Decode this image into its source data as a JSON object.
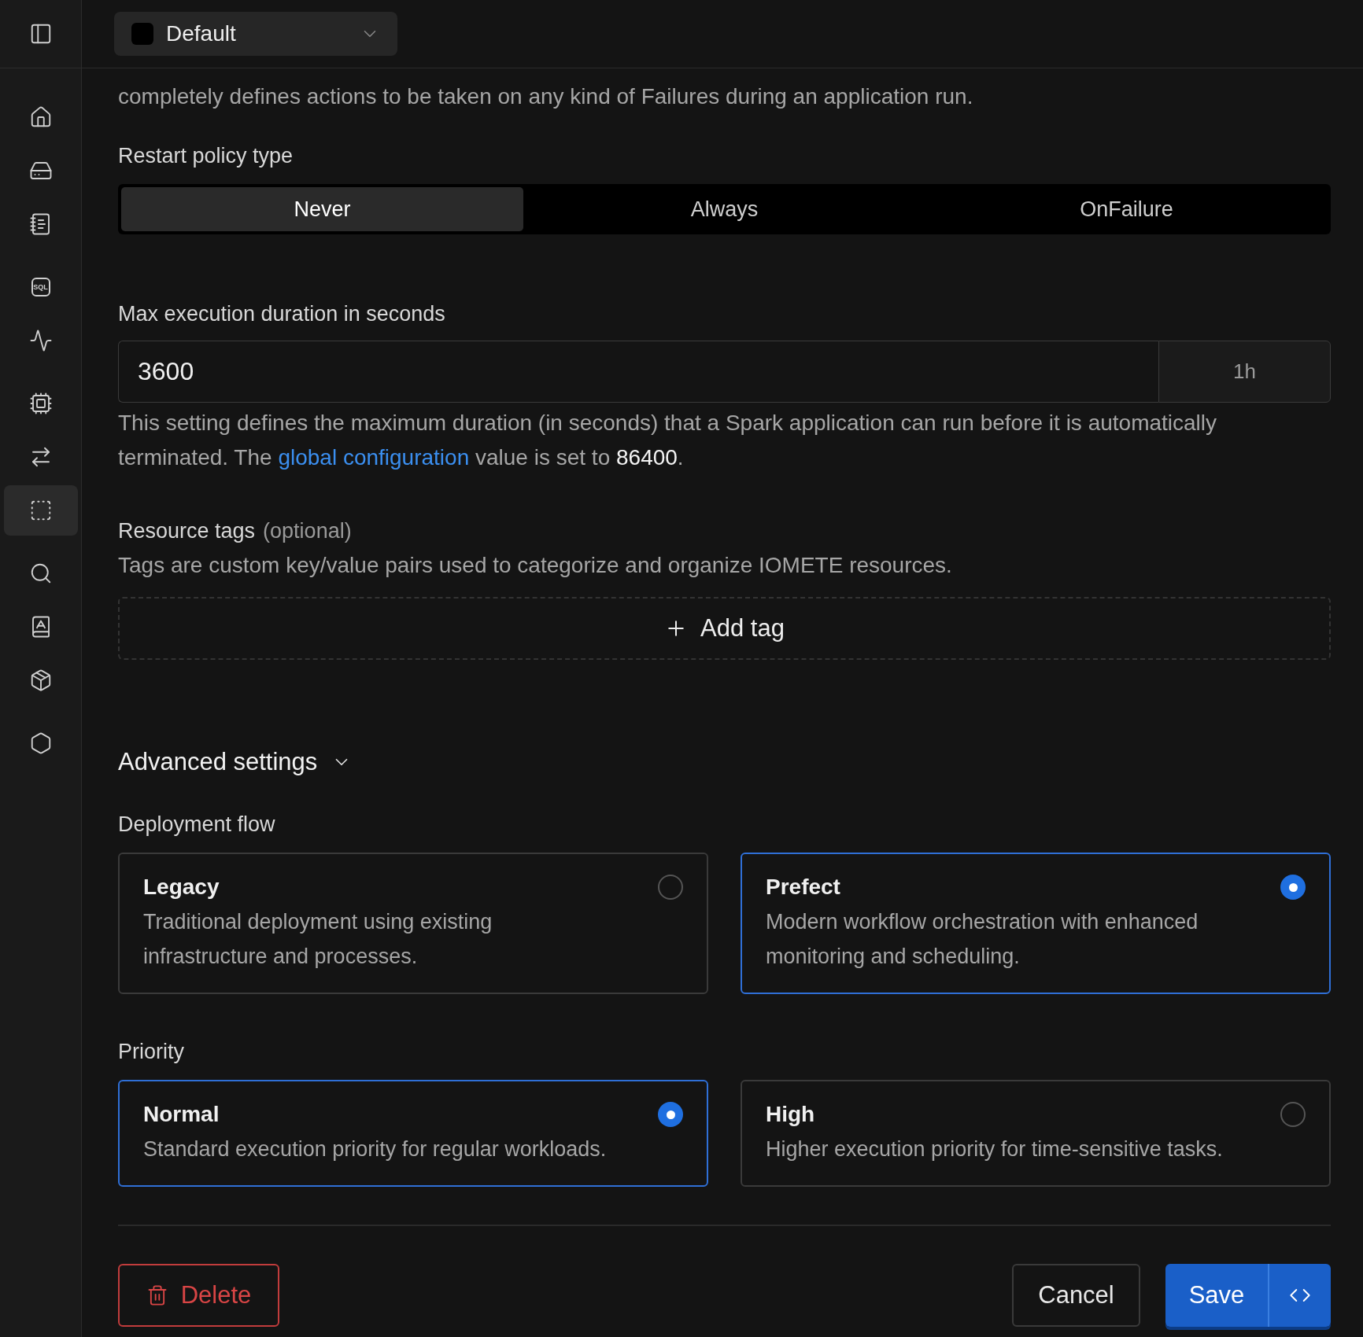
{
  "sidebar": {
    "toggle": {
      "kind": "panel"
    },
    "items": [
      {
        "kind": "home",
        "selected": false
      },
      {
        "kind": "drive",
        "selected": false
      },
      {
        "kind": "notebook",
        "selected": false
      },
      {
        "kind": "sql",
        "label": "SQL",
        "selected": false
      },
      {
        "kind": "activity",
        "selected": false
      },
      {
        "kind": "chip",
        "selected": false
      },
      {
        "kind": "transfer",
        "selected": false
      },
      {
        "kind": "dashed",
        "selected": true
      },
      {
        "kind": "search",
        "selected": false
      },
      {
        "kind": "book",
        "selected": false
      },
      {
        "kind": "package",
        "selected": false
      },
      {
        "kind": "hexagon",
        "selected": false
      }
    ]
  },
  "header": {
    "selector": {
      "label": "Default",
      "color": "#000000"
    }
  },
  "restart_policy": {
    "description": "completely defines actions to be taken on any kind of Failures during an application run.",
    "label": "Restart policy type",
    "options": [
      {
        "label": "Never",
        "selected": true
      },
      {
        "label": "Always",
        "selected": false
      },
      {
        "label": "OnFailure",
        "selected": false
      }
    ]
  },
  "max_duration": {
    "label": "Max execution duration in seconds",
    "value": "3600",
    "suffix": "1h",
    "help": "This setting defines the maximum duration (in seconds) that a Spark application can run before it is automatically terminated. The ",
    "link": "global configuration",
    "help_end": " value is set to ",
    "global_value": "86400",
    "period": "."
  },
  "resource_tags": {
    "label": "Resource tags",
    "optional": "(optional)",
    "description": "Tags are custom key/value pairs used to categorize and organize IOMETE resources.",
    "add_button": "Add tag"
  },
  "advanced": {
    "title": "Advanced settings",
    "expanded": true
  },
  "deployment_flow": {
    "label": "Deployment flow",
    "options": [
      {
        "title": "Legacy",
        "description": "Traditional deployment using existing infrastructure and processes.",
        "selected": false
      },
      {
        "title": "Prefect",
        "description": "Modern workflow orchestration with enhanced monitoring and scheduling.",
        "selected": true
      }
    ]
  },
  "priority": {
    "label": "Priority",
    "options": [
      {
        "title": "Normal",
        "description": "Standard execution priority for regular workloads.",
        "selected": true
      },
      {
        "title": "High",
        "description": "Higher execution priority for time-sensitive tasks.",
        "selected": false
      }
    ]
  },
  "footer": {
    "delete": "Delete",
    "cancel": "Cancel",
    "save": "Save"
  }
}
